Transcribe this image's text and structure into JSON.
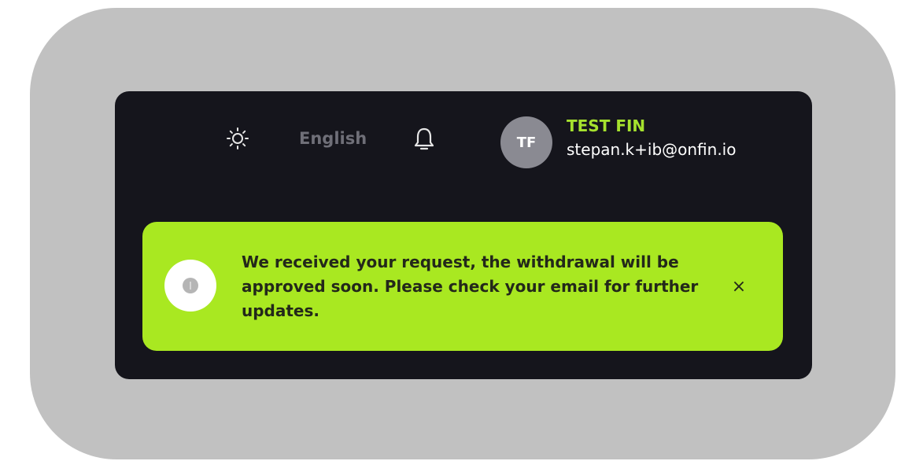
{
  "header": {
    "theme_icon": "sun-icon",
    "language": "English",
    "notification_icon": "bell-icon"
  },
  "user": {
    "initials": "TF",
    "name": "TEST FIN",
    "email": "stepan.k+ib@onfin.io"
  },
  "toast": {
    "icon": "info-icon",
    "message": "We received your request, the withdrawal will be approved soon. Please check your email for further updates.",
    "close_icon": "close-icon",
    "close_label": "×"
  },
  "colors": {
    "frame": "#c1c1c1",
    "panel": "#15151c",
    "accent": "#a9e821",
    "user_name": "#a6e22e",
    "avatar": "#8a8a92"
  }
}
